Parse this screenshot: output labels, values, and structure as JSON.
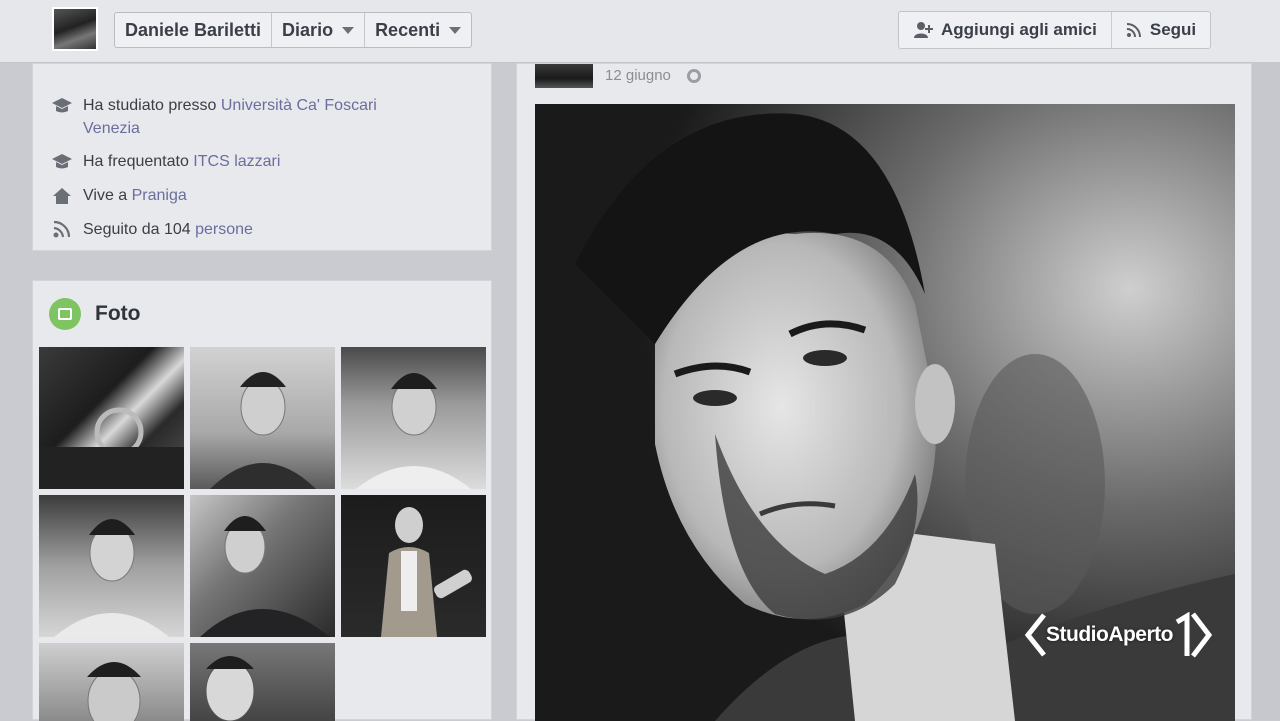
{
  "header": {
    "profile_name": "Daniele Bariletti",
    "nav_diario": "Diario",
    "nav_recenti": "Recenti",
    "add_friend": "Aggiungi agli amici",
    "follow": "Segui"
  },
  "intro": {
    "studied_prefix": "Ha studiato presso ",
    "studied_link_line1": "Università Ca' Foscari",
    "studied_link_line2": "Venezia",
    "attended_prefix": "Ha frequentato ",
    "attended_link": "ITCS lazzari",
    "lives_prefix": "Vive a ",
    "lives_link": "Praniga",
    "followed_prefix": "Seguito da ",
    "followed_count": "104",
    "followed_suffix": " persone"
  },
  "photos": {
    "title": "Foto"
  },
  "post": {
    "date": "12 giugno"
  },
  "watermark": {
    "text": "StudioAperto"
  },
  "colors": {
    "link": "#6a6e9e",
    "foto_icon": "#7fc463",
    "background": "#c9cbd0"
  }
}
